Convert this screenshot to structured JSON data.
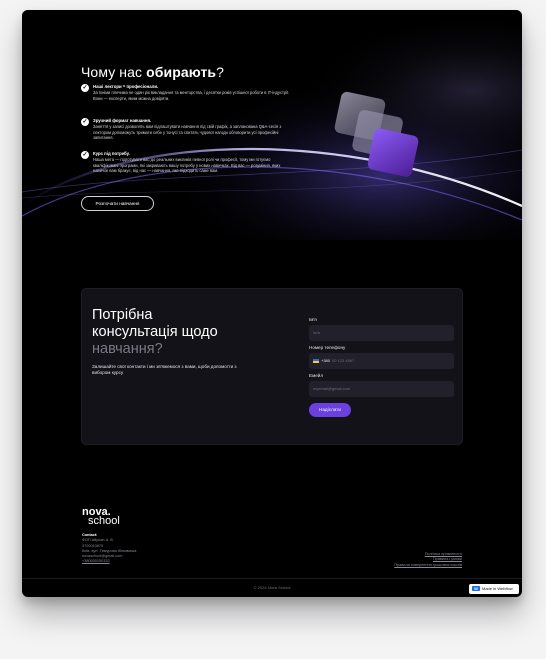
{
  "hero": {
    "title_prefix": "Чому нас ",
    "title_bold": "обирають",
    "title_suffix": "?",
    "features": [
      {
        "title": "Наші лектори = професіонали.",
        "desc": "За їхніми плечима не один рік викладання та менторства, і десятки років успішної роботи в IT-індустрії. Вони — експерти, яким можна довіряти."
      },
      {
        "title": "Зручний формат навчання.",
        "desc": "Заняття у записі дозволять вам підлаштувати навчання під свій графік, а запланована Q&A-сесія з лектором допоможуть тримати себе у тонусі та спитать чудової нагоди обговорити усі професійні запитання."
      },
      {
        "title": "Курс під потребу.",
        "desc": "Наша мета — підготувати вас до реальних викликів певної ролі чи професії, тому ми готуємо кваліфіковані програми, які закривають вашу потребу у нових навичках. Від вас — розуміння, яких навичок вам бракує, від нас — навчання, яке підходить саме вам."
      }
    ],
    "cta_label": "Розпочати навчання",
    "check_glyph": "✓"
  },
  "consult": {
    "title_line1": "Потрібна",
    "title_line2": "консультація щодо",
    "title_line3": "навчання?",
    "subtitle": "Залишайте свої контакти і ми зв'яжемося з вами, щоби допомогти з вибором курсу",
    "form": {
      "name_label": "Ім'я",
      "name_placeholder": "Ім'я",
      "phone_label": "Номер телефону",
      "phone_code": "+380",
      "phone_placeholder": "00 123 4567",
      "email_label": "Емейл",
      "email_placeholder": "myemail@gmail.com",
      "submit_label": "Надіслати"
    }
  },
  "footer": {
    "logo_top": "nova.",
    "logo_bottom": "school",
    "contact_heading": "Contact:",
    "contact_lines": [
      "ФОП Айрьян А. В.",
      "3700010870",
      "Київ, вул. Тимурова Жінківська",
      "novaschool@gmail.com"
    ],
    "contact_phone": "+380930150332",
    "links": [
      "Політика приватності",
      "Правила і умови",
      "Правила повернення грошових коштів"
    ],
    "copyright": "© 2024 Nova School"
  },
  "badge": {
    "label": "Made in Webflow",
    "icon": "webflow-icon",
    "icon_glyph": "W"
  },
  "colors": {
    "accent": "#6b3fe0",
    "background": "#000000",
    "card": "#131219"
  }
}
